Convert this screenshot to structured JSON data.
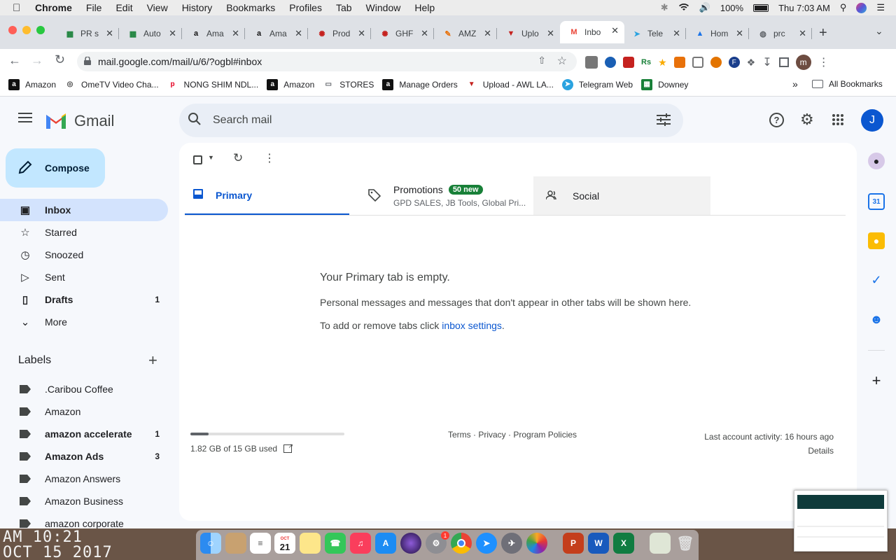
{
  "macbar": {
    "app": "Chrome",
    "menus": [
      "File",
      "Edit",
      "View",
      "History",
      "Bookmarks",
      "Profiles",
      "Tab",
      "Window",
      "Help"
    ],
    "battery": "100%",
    "clock": "Thu 7:03 AM"
  },
  "tabs": [
    {
      "title": "PR s",
      "icon": "sheets-icon",
      "color": "#188038"
    },
    {
      "title": "Auto",
      "icon": "sheets-icon",
      "color": "#188038"
    },
    {
      "title": "Ama",
      "icon": "amazon-icon",
      "color": "#111"
    },
    {
      "title": "Ama",
      "icon": "amazon-icon",
      "color": "#111"
    },
    {
      "title": "Prod",
      "icon": "peppermint-icon",
      "color": "#c5221f"
    },
    {
      "title": "GHF",
      "icon": "peppermint-icon",
      "color": "#c5221f"
    },
    {
      "title": "AMZ",
      "icon": "pencil-icon",
      "color": "#e8710a"
    },
    {
      "title": "Uplo",
      "icon": "awl-icon",
      "color": "#c5221f"
    },
    {
      "title": "Inbo",
      "icon": "gmail-icon",
      "color": "#ea4335",
      "active": true
    },
    {
      "title": "Tele",
      "icon": "telegram-icon",
      "color": "#2aa3e0"
    },
    {
      "title": "Hom",
      "icon": "drive-icon",
      "color": "#1a73e8"
    },
    {
      "title": "prc",
      "icon": "globe-icon",
      "color": "#5f6368"
    }
  ],
  "omnibox": {
    "url": "mail.google.com/mail/u/6/?ogbl#inbox"
  },
  "bookmarks": [
    {
      "label": "Amazon",
      "icon": "amazon-icon"
    },
    {
      "label": "OmeTV Video Cha...",
      "icon": "ometv-icon"
    },
    {
      "label": "NONG SHIM NDL...",
      "icon": "pinterest-icon"
    },
    {
      "label": "Amazon",
      "icon": "amazon-icon"
    },
    {
      "label": "STORES",
      "icon": "folder-icon"
    },
    {
      "label": "Manage Orders",
      "icon": "amazon-icon"
    },
    {
      "label": "Upload - AWL LA...",
      "icon": "awl-icon"
    },
    {
      "label": "Telegram Web",
      "icon": "telegram-icon"
    },
    {
      "label": "Downey",
      "icon": "sheets-icon"
    }
  ],
  "bookmarks_more": "»",
  "all_bookmarks": "All Bookmarks",
  "gmail": {
    "logo": "Gmail",
    "search_placeholder": "Search mail",
    "avatar": "J",
    "compose": "Compose",
    "nav": [
      {
        "label": "Inbox",
        "icon": "inbox-icon",
        "count": "",
        "active": true
      },
      {
        "label": "Starred",
        "icon": "star-icon",
        "count": ""
      },
      {
        "label": "Snoozed",
        "icon": "clock-icon",
        "count": ""
      },
      {
        "label": "Sent",
        "icon": "send-icon",
        "count": ""
      },
      {
        "label": "Drafts",
        "icon": "draft-icon",
        "count": "1",
        "bold": true
      },
      {
        "label": "More",
        "icon": "chevron-down-icon",
        "count": ""
      }
    ],
    "labels_title": "Labels",
    "labels": [
      {
        "label": ".Caribou Coffee",
        "count": ""
      },
      {
        "label": "Amazon",
        "count": ""
      },
      {
        "label": "amazon accelerate",
        "count": "1",
        "bold": true
      },
      {
        "label": "Amazon Ads",
        "count": "3",
        "bold": true
      },
      {
        "label": "Amazon Answers",
        "count": ""
      },
      {
        "label": "Amazon Business",
        "count": ""
      },
      {
        "label": "amazon corporate",
        "count": ""
      }
    ],
    "tabs": {
      "primary": "Primary",
      "promotions": "Promotions",
      "promotions_badge": "50 new",
      "promotions_sub": "GPD SALES, JB Tools, Global Pri...",
      "social": "Social"
    },
    "empty": {
      "title": "Your Primary tab is empty.",
      "body": "Personal messages and messages that don't appear in other tabs will be shown here.",
      "settings_prefix": "To add or remove tabs click ",
      "settings_link": "inbox settings",
      "settings_suffix": "."
    },
    "footer": {
      "storage": "1.82 GB of 15 GB used",
      "storage_fraction": 0.12,
      "terms": "Terms",
      "privacy": "Privacy",
      "policies": "Program Policies",
      "sep": " · ",
      "activity": "Last account activity: 16 hours ago",
      "details": "Details"
    }
  },
  "wallpaper": {
    "line1": "AM 10:21",
    "line2": "OCT 15 2017"
  },
  "dock": {
    "calendar_day": "21",
    "calendar_month": "OCT",
    "settings_badge": "1"
  }
}
